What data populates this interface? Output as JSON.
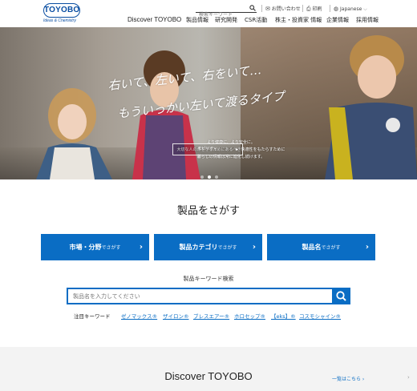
{
  "header": {
    "logo_text": "TOYOBO",
    "logo_tagline": "Ideas & Chemistry",
    "search_placeholder": "検索キーワード",
    "contact": "お問い合わせ",
    "print": "印刷",
    "language": "Japanese",
    "nav": [
      "Discover TOYOBO",
      "製品情報",
      "研究開発",
      "CSR活動",
      "株主・投資家 情報",
      "企業情報",
      "採用情報"
    ]
  },
  "hero": {
    "headline_1": "右いて、左いて、右をいて…",
    "headline_2": "もういっかい左いて渡るタイプ",
    "sub_1": "より健康に、より安全に。",
    "sub_2": "大切な人の命を守るためにあるべき快適性をもたらすために",
    "sub_3": "暮らしの情報は常に進化し続けます。",
    "button": "モビリティ",
    "dot_count": 3,
    "active_dot": 1
  },
  "products": {
    "title": "製品をさがす",
    "buttons": [
      {
        "main": "市場・分野",
        "suffix": "でさがす"
      },
      {
        "main": "製品カテゴリ",
        "suffix": "でさがす"
      },
      {
        "main": "製品名",
        "suffix": "でさがす"
      }
    ],
    "keyword_title": "製品キーワード検索",
    "keyword_placeholder": "製品名を入力してください",
    "hot_label": "注目キーワード",
    "hot_keywords": [
      "ゼノマックス®",
      "ザイロン®",
      "ブレスエアー®",
      "ホロセップ®",
      "【eks】®",
      "コスモシャイン®"
    ]
  },
  "discover": {
    "title": "Discover TOYOBO",
    "link": "一覧はこちら ›"
  },
  "colors": {
    "brand_blue": "#0a6dc4",
    "logo_blue": "#0a4ea2"
  }
}
